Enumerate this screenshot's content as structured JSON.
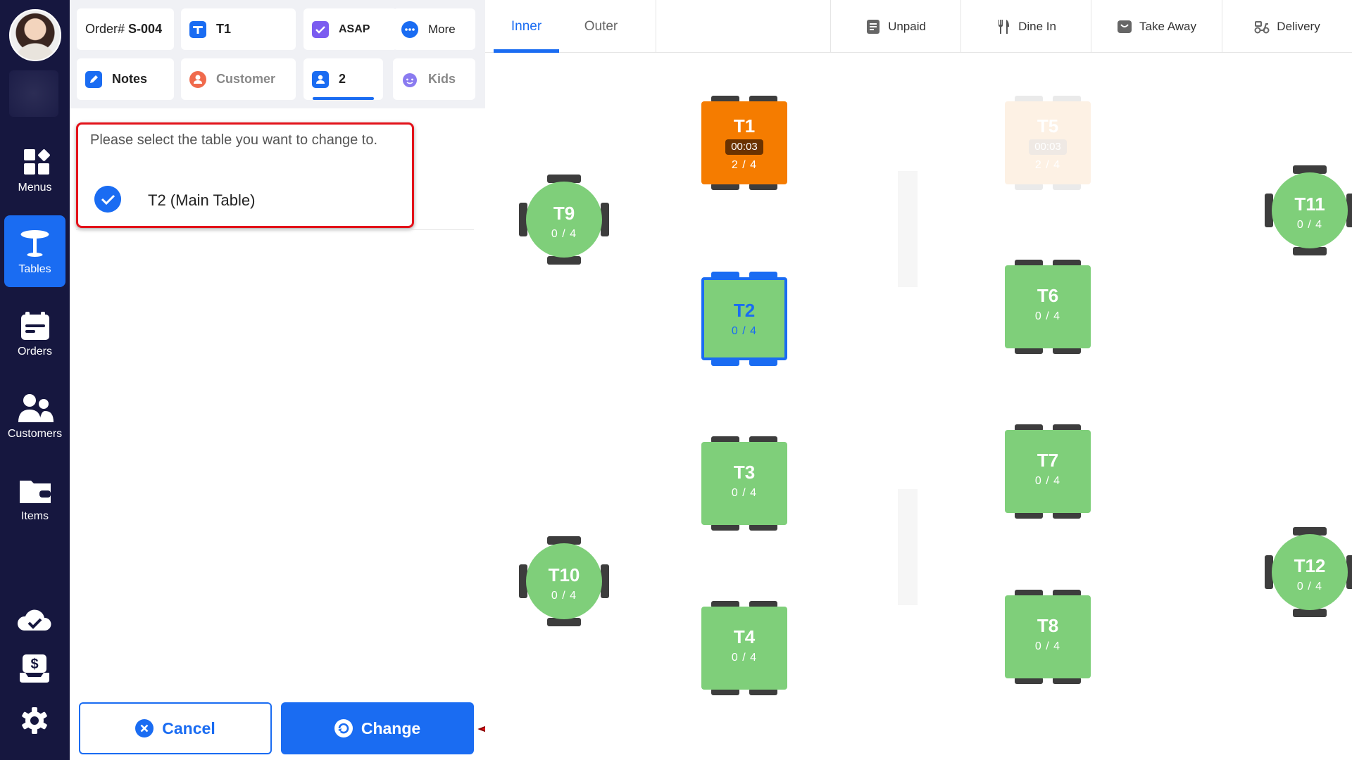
{
  "nav": {
    "items": [
      {
        "label": "Menus",
        "icon": "menus-grid-icon"
      },
      {
        "label": "Tables",
        "icon": "table-icon"
      },
      {
        "label": "Orders",
        "icon": "orders-icon"
      },
      {
        "label": "Customers",
        "icon": "customers-icon"
      },
      {
        "label": "Items",
        "icon": "items-folder-icon"
      }
    ],
    "active": "Tables",
    "bottom_icons": [
      "cloud-check-icon",
      "cash-drawer-icon",
      "gear-icon"
    ]
  },
  "order": {
    "number_prefix": "Order#",
    "number": "S-004",
    "table": "T1",
    "timing": "ASAP",
    "more": "More",
    "notes": "Notes",
    "customer": "Customer",
    "guests": "2",
    "kids": "Kids"
  },
  "change_table": {
    "hint": "Please select the table you want to change to.",
    "selected": "T2 (Main Table)",
    "cancel_label": "Cancel",
    "change_label": "Change"
  },
  "floor": {
    "tabs": [
      "Inner",
      "Outer"
    ],
    "active_tab": "Inner",
    "filters": [
      {
        "label": "Unpaid",
        "icon": "receipt-icon"
      },
      {
        "label": "Dine In",
        "icon": "fork-knife-icon"
      },
      {
        "label": "Take Away",
        "icon": "take-away-bag-icon"
      },
      {
        "label": "Delivery",
        "icon": "delivery-scooter-icon"
      }
    ],
    "tables": [
      {
        "id": "T1",
        "occupancy": "2 / 4",
        "timer": "00:03",
        "status": "occupied"
      },
      {
        "id": "T2",
        "occupancy": "0 / 4",
        "status": "selected"
      },
      {
        "id": "T3",
        "occupancy": "0 / 4",
        "status": "free"
      },
      {
        "id": "T4",
        "occupancy": "0 / 4",
        "status": "free"
      },
      {
        "id": "T5",
        "occupancy": "2 / 4",
        "timer": "00:03",
        "status": "faded"
      },
      {
        "id": "T6",
        "occupancy": "0 / 4",
        "status": "free"
      },
      {
        "id": "T7",
        "occupancy": "0 / 4",
        "status": "free"
      },
      {
        "id": "T8",
        "occupancy": "0 / 4",
        "status": "free"
      },
      {
        "id": "T9",
        "occupancy": "0 / 4",
        "status": "free"
      },
      {
        "id": "T10",
        "occupancy": "0 / 4",
        "status": "free"
      },
      {
        "id": "T11",
        "occupancy": "0 / 4",
        "status": "free"
      },
      {
        "id": "T12",
        "occupancy": "0 / 4",
        "status": "free"
      }
    ]
  },
  "colors": {
    "nav_bg": "#16173f",
    "accent": "#1a6cf2",
    "free_table": "#7fcf7a",
    "occupied_table": "#f57c00",
    "highlight_border": "#e3121a"
  }
}
